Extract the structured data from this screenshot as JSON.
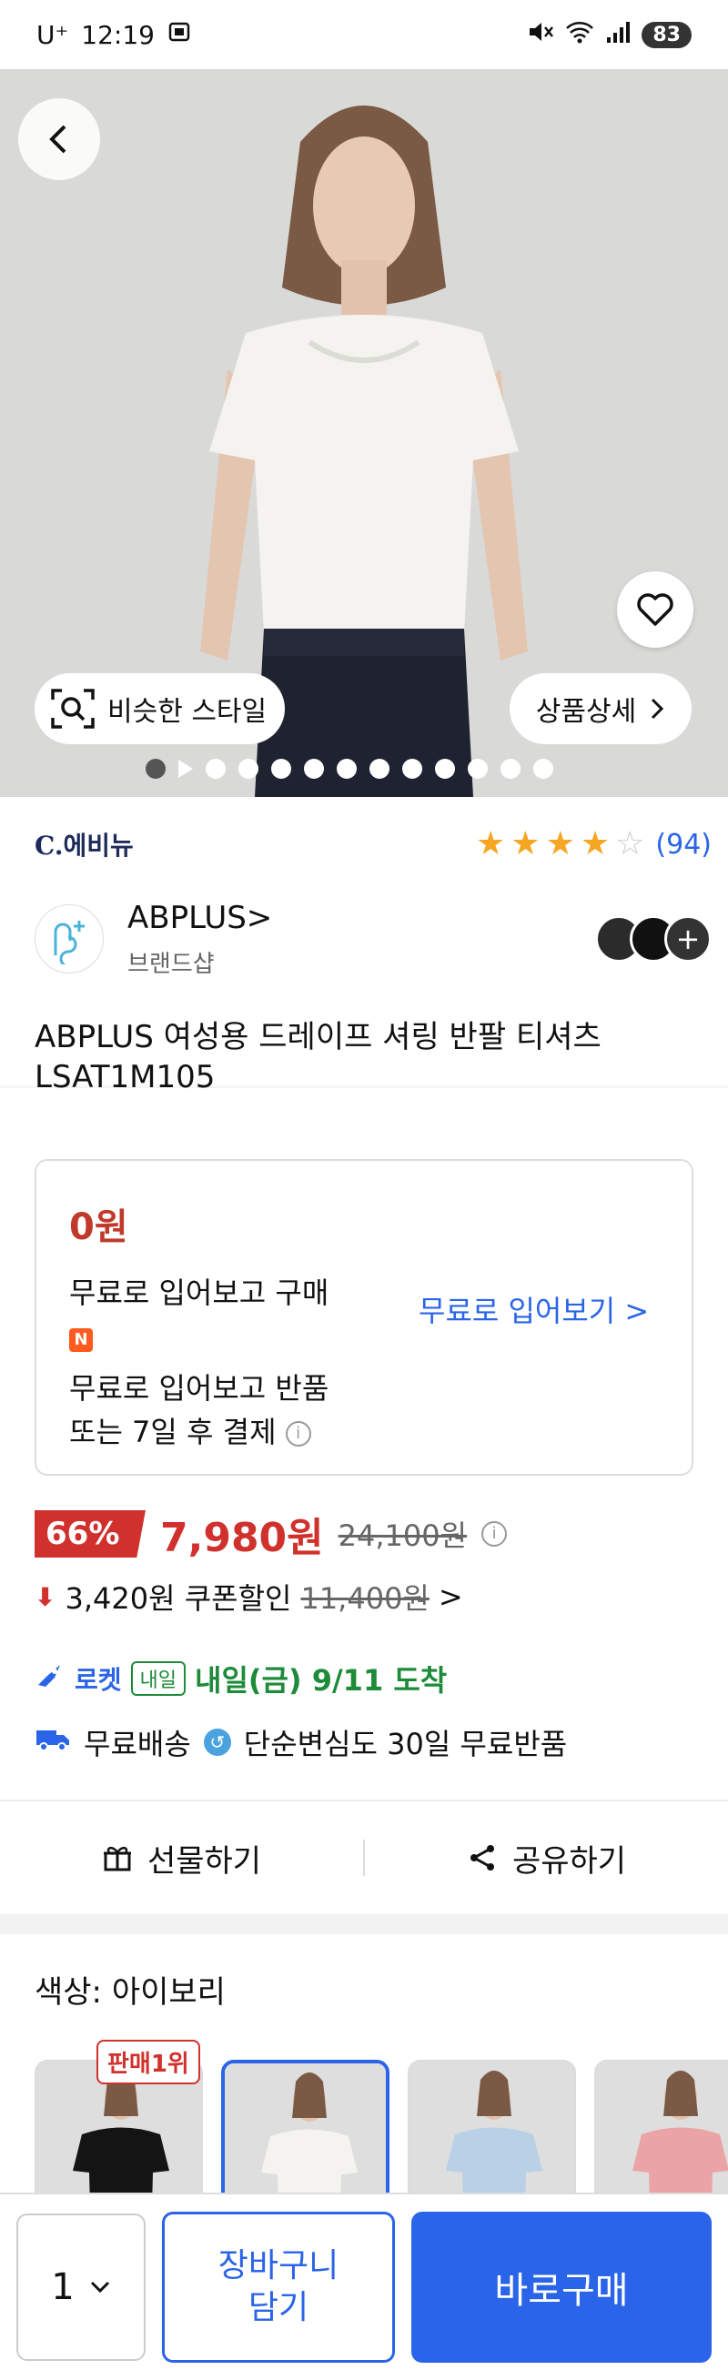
{
  "status_bar": {
    "carrier": "U⁺",
    "time": "12:19",
    "battery": "83"
  },
  "hero": {
    "similar_style_label": "비슷한 스타일",
    "detail_label": "상품상세",
    "image_count": 12,
    "active_index": 0
  },
  "seller": {
    "name": "C.에비뉴",
    "rating": 4,
    "rating_count": "(94)"
  },
  "brand": {
    "name": "ABPLUS>",
    "sub": "브랜드샵",
    "swatch_colors": [
      "#2b2b2b",
      "#111111",
      "#333333"
    ]
  },
  "product": {
    "title": "ABPLUS 여성용 드레이프 셔링 반팔 티셔츠 LSAT1M105"
  },
  "trial": {
    "price": "0원",
    "line1": "무료로 입어보고 구매",
    "pay_icon": "N",
    "line2": "무료로 입어보고 반품",
    "line3": "또는 7일 후 결제",
    "info_icon": "i",
    "link": "무료로 입어보기 >"
  },
  "price": {
    "discount": "66%",
    "sale": "7,980원",
    "original": "24,100원"
  },
  "coupon": {
    "text": "3,420원 쿠폰할인",
    "original": "11,400원",
    "chevron": ">"
  },
  "delivery": {
    "rocket": "로켓",
    "badge": "내일",
    "date": "내일(금) 9/11 도착"
  },
  "shipping": {
    "free": "무료배송",
    "return": "단순변심도 30일 무료반품"
  },
  "actions": {
    "gift": "선물하기",
    "share": "공유하기"
  },
  "color": {
    "label": "색상: 아이보리",
    "bestseller": "판매1위",
    "thumbs": [
      "black",
      "ivory",
      "skyblue",
      "pink"
    ]
  },
  "bottom": {
    "qty": "1",
    "cart": "장바구니\n담기",
    "buy": "바로구매"
  },
  "colors": {
    "accent": "#2a64e8",
    "sale": "#d0312d",
    "delivery": "#1e8b3a",
    "star": "#f5a623"
  }
}
